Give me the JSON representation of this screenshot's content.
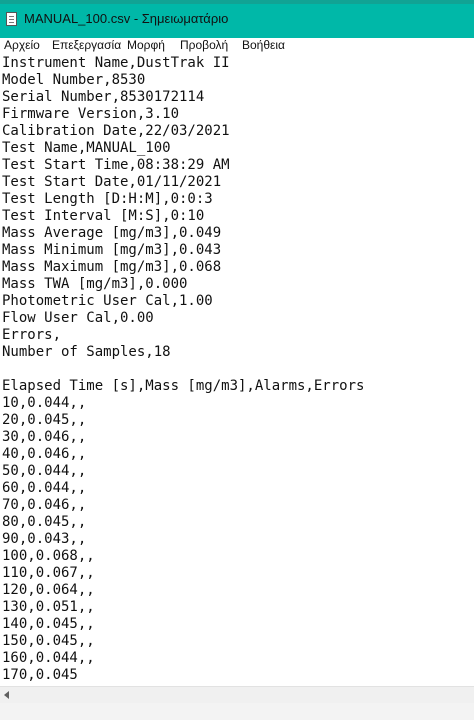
{
  "window": {
    "title": "MANUAL_100.csv - Σημειωματάριο",
    "icon": "notepad-document-icon",
    "accent_color": "#00b8a8"
  },
  "menu": {
    "items": [
      {
        "label": "Αρχείο"
      },
      {
        "label": "Επεξεργασία"
      },
      {
        "label": "Μορφή"
      },
      {
        "label": "Προβολή"
      },
      {
        "label": "Βοήθεια"
      }
    ]
  },
  "document": {
    "lines": [
      "Instrument Name,DustTrak II",
      "Model Number,8530",
      "Serial Number,8530172114",
      "Firmware Version,3.10",
      "Calibration Date,22/03/2021",
      "Test Name,MANUAL_100",
      "Test Start Time,08:38:29 AM",
      "Test Start Date,01/11/2021",
      "Test Length [D:H:M],0:0:3",
      "Test Interval [M:S],0:10",
      "Mass Average [mg/m3],0.049",
      "Mass Minimum [mg/m3],0.043",
      "Mass Maximum [mg/m3],0.068",
      "Mass TWA [mg/m3],0.000",
      "Photometric User Cal,1.00",
      "Flow User Cal,0.00",
      "Errors,",
      "Number of Samples,18",
      "",
      "Elapsed Time [s],Mass [mg/m3],Alarms,Errors",
      "10,0.044,,",
      "20,0.045,,",
      "30,0.046,,",
      "40,0.046,,",
      "50,0.044,,",
      "60,0.044,,",
      "70,0.046,,",
      "80,0.045,,",
      "90,0.043,,",
      "100,0.068,,",
      "110,0.067,,",
      "120,0.064,,",
      "130,0.051,,",
      "140,0.045,,",
      "150,0.045,,",
      "160,0.044,,",
      "170,0.045"
    ]
  }
}
